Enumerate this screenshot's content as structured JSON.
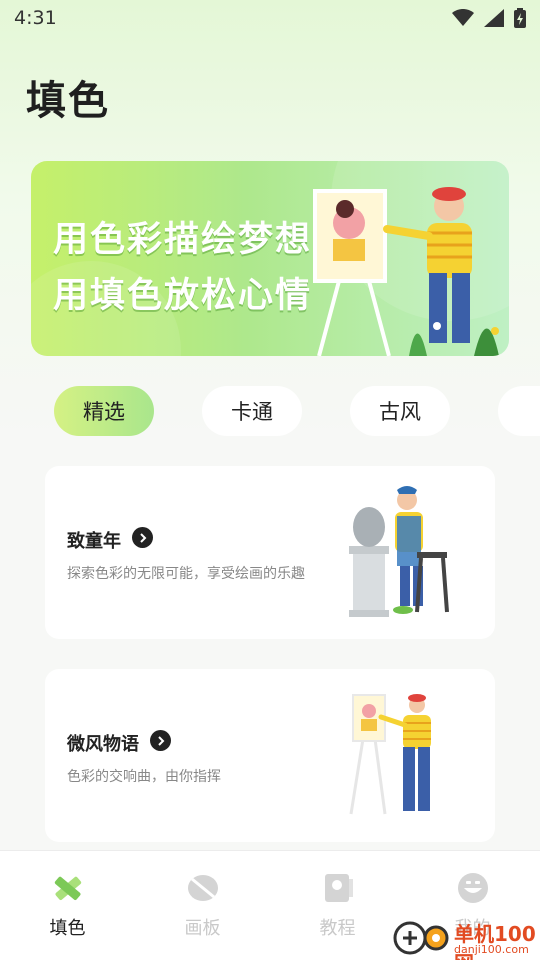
{
  "status_bar": {
    "time": "4:31",
    "icons": [
      "wifi-icon",
      "signal-icon",
      "battery-charging-icon"
    ]
  },
  "page": {
    "title": "填色"
  },
  "banner": {
    "line1": "用色彩描绘梦想",
    "line2": "用填色放松心情"
  },
  "categories": [
    {
      "label": "精选",
      "active": true
    },
    {
      "label": "卡通",
      "active": false
    },
    {
      "label": "古风",
      "active": false
    }
  ],
  "cards": [
    {
      "title": "致童年",
      "subtitle": "探索色彩的无限可能，享受绘画的乐趣",
      "icon": "chevron-right-icon"
    },
    {
      "title": "微风物语",
      "subtitle": "色彩的交响曲，由你指挥",
      "icon": "chevron-right-icon"
    }
  ],
  "tabbar": {
    "items": [
      {
        "label": "填色",
        "icon": "brush-ruler-icon",
        "active": true
      },
      {
        "label": "画板",
        "icon": "palette-icon",
        "active": false
      },
      {
        "label": "教程",
        "icon": "tutorial-book-icon",
        "active": false
      },
      {
        "label": "我的",
        "icon": "smiley-face-icon",
        "active": false
      }
    ]
  },
  "watermark": {
    "name": "单机100网",
    "url": "danji100.com"
  },
  "colors": {
    "accent_green": "#a9e68c",
    "accent_lime": "#d5f184",
    "text_dark": "#222222",
    "text_gray": "#888888",
    "tab_inactive": "#c9c9c9",
    "watermark_orange": "#e24b22"
  }
}
